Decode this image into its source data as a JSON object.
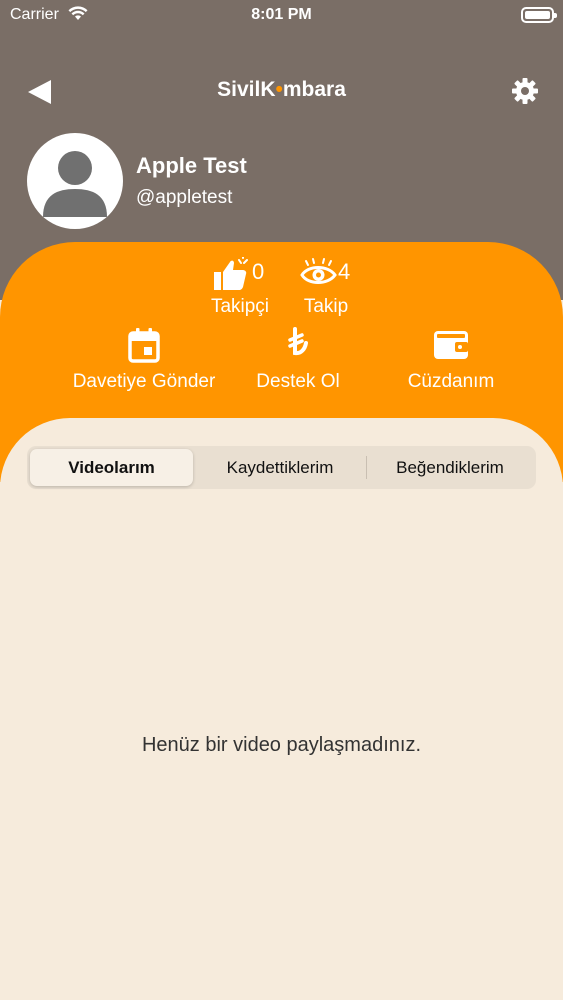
{
  "status_bar": {
    "carrier": "Carrier",
    "time": "8:01 PM"
  },
  "header": {
    "logo_part1": "Sivil",
    "logo_part2": "K",
    "logo_part3": "mbara",
    "back_icon": "back-arrow-icon",
    "settings_icon": "gear-icon"
  },
  "profile": {
    "name": "Apple Test",
    "handle": "@appletest"
  },
  "stats": {
    "followers_count": "0",
    "followers_label": "Takipçi",
    "following_count": "4",
    "following_label": "Takip"
  },
  "actions": {
    "invite_label": "Davetiye Gönder",
    "support_label": "Destek Ol",
    "wallet_label": "Cüzdanım"
  },
  "tabs": {
    "items": [
      {
        "label": "Videolarım",
        "selected": true
      },
      {
        "label": "Kaydettiklerim",
        "selected": false
      },
      {
        "label": "Beğendiklerim",
        "selected": false
      }
    ]
  },
  "empty_state": {
    "message": "Henüz bir video paylaşmadınız."
  },
  "colors": {
    "header_bg": "#7a6e66",
    "accent": "#ff9500",
    "content_bg": "#f6ebdc"
  }
}
